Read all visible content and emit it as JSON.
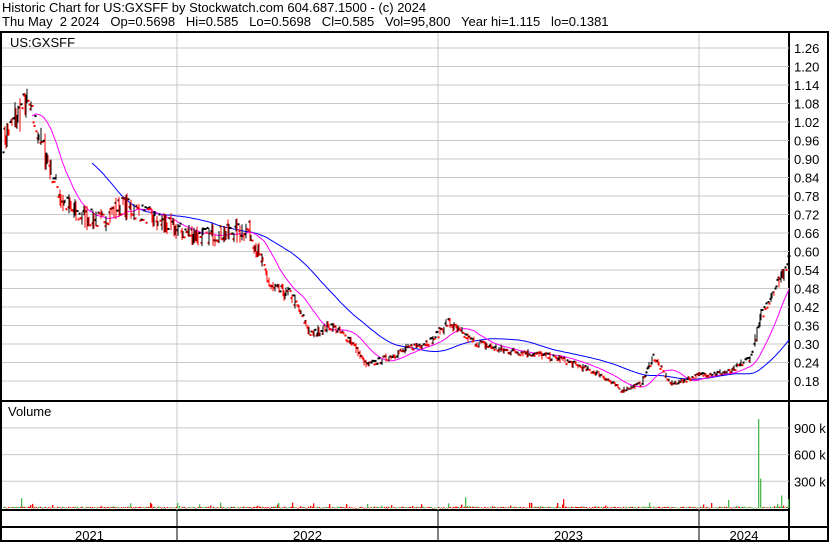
{
  "header": {
    "title": "Historic Chart for US:GXSFF by Stockwatch.com 604.687.1500 - (c) 2024",
    "quote_line": "Thu May  2 2024   Op=0.5698   Hi=0.585   Lo=0.5698   Cl=0.585   Vol=95,800   Year hi=1.115   lo=0.1381"
  },
  "chart_data": {
    "type": "line",
    "title": "Historic Chart for US:GXSFF",
    "symbol": "US:GXSFF",
    "volume_label": "Volume",
    "price_ticks": [
      "1.26",
      "1.20",
      "1.14",
      "1.08",
      "1.02",
      "0.96",
      "0.90",
      "0.84",
      "0.78",
      "0.72",
      "0.66",
      "0.60",
      "0.54",
      "0.48",
      "0.42",
      "0.36",
      "0.30",
      "0.24",
      "0.18"
    ],
    "price_ylim": [
      0.12,
      1.3
    ],
    "volume_ticks": [
      "900 k",
      "600 k",
      "300 k"
    ],
    "volume_tick_values": [
      900000,
      600000,
      300000
    ],
    "x_labels": [
      "2021",
      "2022",
      "2023",
      "2024"
    ],
    "year_start_day": [
      -87,
      174,
      435,
      696
    ],
    "last_day": 786,
    "close_keypoints_day_price": [
      [
        0,
        0.96
      ],
      [
        23,
        1.09
      ],
      [
        38,
        0.96
      ],
      [
        58,
        0.77
      ],
      [
        73,
        0.72
      ],
      [
        98,
        0.7
      ],
      [
        118,
        0.75
      ],
      [
        143,
        0.72
      ],
      [
        173,
        0.67
      ],
      [
        198,
        0.65
      ],
      [
        246,
        0.67
      ],
      [
        258,
        0.57
      ],
      [
        268,
        0.48
      ],
      [
        288,
        0.46
      ],
      [
        308,
        0.33
      ],
      [
        328,
        0.36
      ],
      [
        348,
        0.31
      ],
      [
        363,
        0.23
      ],
      [
        388,
        0.26
      ],
      [
        408,
        0.29
      ],
      [
        428,
        0.31
      ],
      [
        445,
        0.37
      ],
      [
        468,
        0.31
      ],
      [
        498,
        0.28
      ],
      [
        528,
        0.27
      ],
      [
        558,
        0.25
      ],
      [
        598,
        0.2
      ],
      [
        618,
        0.15
      ],
      [
        638,
        0.17
      ],
      [
        650,
        0.26
      ],
      [
        668,
        0.17
      ],
      [
        698,
        0.2
      ],
      [
        728,
        0.21
      ],
      [
        748,
        0.26
      ],
      [
        758,
        0.39
      ],
      [
        768,
        0.46
      ],
      [
        778,
        0.52
      ],
      [
        786,
        0.585
      ]
    ],
    "volume_spikes_day_value": [
      [
        755,
        1000000
      ],
      [
        757,
        330000
      ],
      [
        778,
        140000
      ],
      [
        785,
        100000
      ],
      [
        462,
        120000
      ],
      [
        560,
        100000
      ],
      [
        725,
        90000
      ],
      [
        18,
        110000
      ]
    ],
    "series": [
      {
        "name": "Price bars",
        "color": "#000000"
      },
      {
        "name": "Short moving average",
        "color": "#ff00ff"
      },
      {
        "name": "Long moving average",
        "color": "#0000ff"
      }
    ],
    "grid": true
  }
}
